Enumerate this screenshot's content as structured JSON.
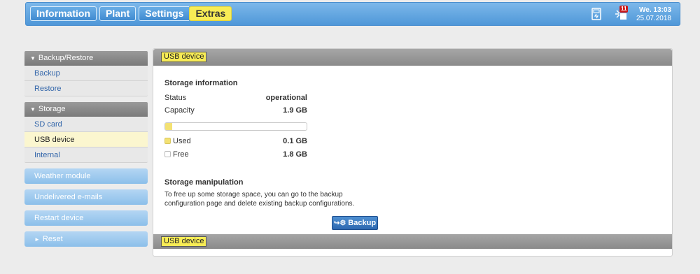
{
  "topbar": {
    "tabs": [
      "Information",
      "Plant",
      "Settings",
      "Extras"
    ],
    "alert_count": "11",
    "day_time": "We. 13:03",
    "date": "25.07.2018"
  },
  "sidebar": {
    "backup_group": "Backup/Restore",
    "backup_items": [
      "Backup",
      "Restore"
    ],
    "storage_group": "Storage",
    "storage_items": [
      "SD card",
      "USB device",
      "Internal"
    ],
    "buttons": [
      "Weather module",
      "Undelivered e-mails",
      "Restart device",
      "Reset"
    ]
  },
  "panel": {
    "header": "USB device",
    "footer": "USB device",
    "storage_info_title": "Storage information",
    "status_label": "Status",
    "status_value": "operational",
    "capacity_label": "Capacity",
    "capacity_value": "1.9 GB",
    "usage_fraction": 0.05,
    "used_label": "Used",
    "used_value": "0.1 GB",
    "free_label": "Free",
    "free_value": "1.8 GB",
    "manipulation_title": "Storage manipulation",
    "manipulation_text": "To free up some storage space, you can go to the backup configuration page and delete existing backup configurations.",
    "backup_button": "Backup"
  },
  "colors": {
    "accent": "#4f97d8",
    "highlight": "#f8ec55"
  }
}
